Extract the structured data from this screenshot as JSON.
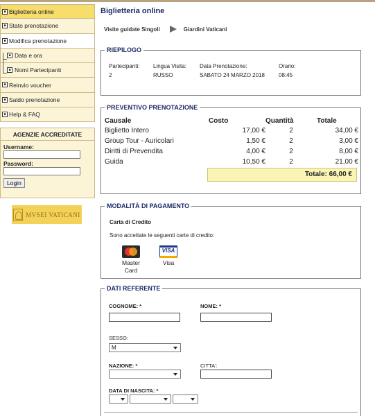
{
  "sidebar": {
    "items": [
      {
        "label": "Biglietteria online",
        "state": "active"
      },
      {
        "label": "Stato prenotazione",
        "state": "normal"
      },
      {
        "label": "Modifica prenotazione",
        "state": "open"
      },
      {
        "label": "Data e ora",
        "state": "sub"
      },
      {
        "label": "Nomi Partecipanti",
        "state": "sub"
      },
      {
        "label": "Reinvio voucher",
        "state": "normal"
      },
      {
        "label": "Saldo prenotazione",
        "state": "normal"
      },
      {
        "label": "Help & FAQ",
        "state": "normal"
      }
    ]
  },
  "agency": {
    "title": "AGENZIE ACCREDITATE",
    "username_label": "Username:",
    "password_label": "Password:",
    "login_label": "Login"
  },
  "logo": {
    "text": "MVSEI VATICANI"
  },
  "page": {
    "title": "Biglietteria online",
    "breadcrumb_1": "Visite guidate Singoli",
    "breadcrumb_2": "Giardini Vaticani"
  },
  "riepilogo": {
    "title": "RIEPILOGO",
    "participants_label": "Partecipanti:",
    "participants_value": "2",
    "language_label": "Lingua Visita:",
    "language_value": "RUSSO",
    "date_label": "Data Prenotazione:",
    "date_value": "SABATO 24 MARZO 2018",
    "time_label": "Orario:",
    "time_value": "08:45"
  },
  "preventivo": {
    "title": "PREVENTIVO PRENOTAZIONE",
    "headers": {
      "causale": "Causale",
      "costo": "Costo",
      "quantita": "Quantità",
      "totale": "Totale"
    },
    "rows": [
      {
        "causale": "Biglietto Intero",
        "costo": "17,00 €",
        "quantita": "2",
        "totale": "34,00 €"
      },
      {
        "causale": "Group Tour - Auricolari",
        "costo": "1,50 €",
        "quantita": "2",
        "totale": "3,00 €"
      },
      {
        "causale": "Diritti di Prevendita",
        "costo": "4,00 €",
        "quantita": "2",
        "totale": "8,00 €"
      },
      {
        "causale": "Guida",
        "costo": "10,50 €",
        "quantita": "2",
        "totale": "21,00 €"
      }
    ],
    "total_text": "Totale: 66,00 €"
  },
  "pagamento": {
    "title": "MODALITÀ DI PAGAMENTO",
    "method": "Carta di Credito",
    "description": "Sono accettate le seguenti carte di credito:",
    "card_1_line1": "Master",
    "card_1_line2": "Card",
    "card_2": "Visa"
  },
  "referente": {
    "title": "DATI REFERENTE",
    "cognome_label": "COGNOME: *",
    "nome_label": "NOME: *",
    "sesso_label": "SESSO:",
    "sesso_value": "M",
    "nazione_label": "NAZIONE: *",
    "citta_label": "CITTA':",
    "nascita_label": "DATA DI NASCITA: *"
  }
}
